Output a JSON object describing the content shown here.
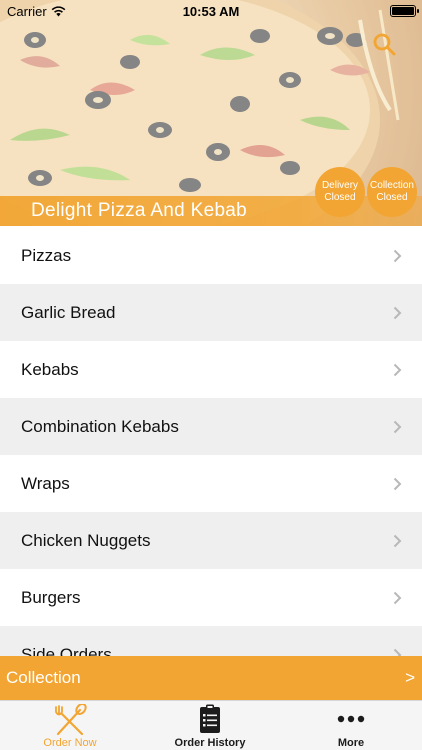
{
  "status_bar": {
    "carrier": "Carrier",
    "time": "10:53 AM"
  },
  "header": {
    "title": "Delight Pizza And Kebab",
    "search_icon": "search-icon",
    "badges": {
      "delivery": {
        "line1": "Delivery",
        "line2": "Closed"
      },
      "collection": {
        "line1": "Collection",
        "line2": "Closed"
      }
    }
  },
  "menu": {
    "items": [
      {
        "label": "Pizzas"
      },
      {
        "label": "Garlic Bread"
      },
      {
        "label": "Kebabs"
      },
      {
        "label": "Combination Kebabs"
      },
      {
        "label": "Wraps"
      },
      {
        "label": "Chicken Nuggets"
      },
      {
        "label": "Burgers"
      },
      {
        "label": "Side Orders"
      }
    ],
    "chevron_icon": "chevron-right-icon"
  },
  "collection_bar": {
    "label": "Collection",
    "arrow": ">"
  },
  "tab_bar": {
    "tabs": [
      {
        "label": "Order Now",
        "icon": "fork-spoon-icon",
        "active": true
      },
      {
        "label": "Order History",
        "icon": "clipboard-list-icon",
        "active": false
      },
      {
        "label": "More",
        "icon": "more-dots-icon",
        "active": false
      }
    ]
  },
  "colors": {
    "accent": "#f2a532",
    "row_alt": "#efefef",
    "tab_bar_bg": "#f5f5f5"
  }
}
